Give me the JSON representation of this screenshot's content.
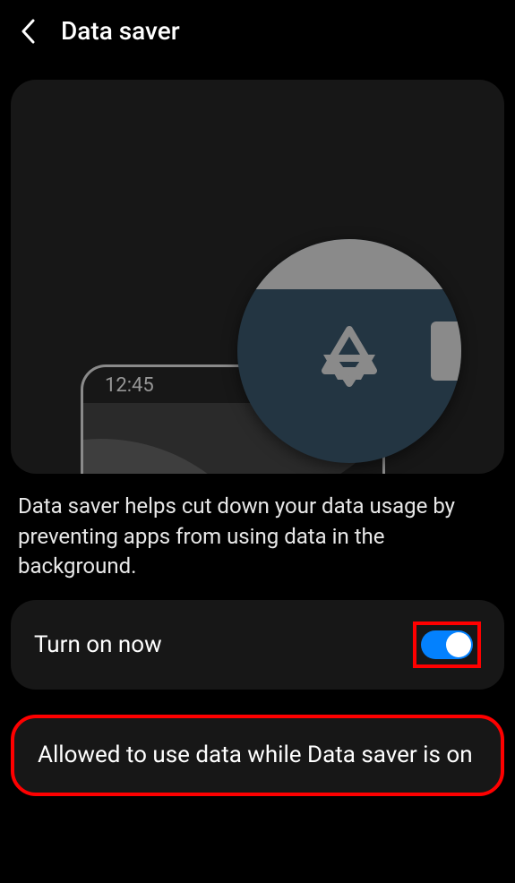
{
  "header": {
    "title": "Data saver"
  },
  "illustration": {
    "phone_time": "12:45"
  },
  "description": "Data saver helps cut down your data usage by preventing apps from using data in the background.",
  "toggle": {
    "label": "Turn on now",
    "state": true
  },
  "option": {
    "label": "Allowed to use data while Data saver is on"
  },
  "colors": {
    "highlight": "#ff0000",
    "accent": "#0381fe"
  }
}
